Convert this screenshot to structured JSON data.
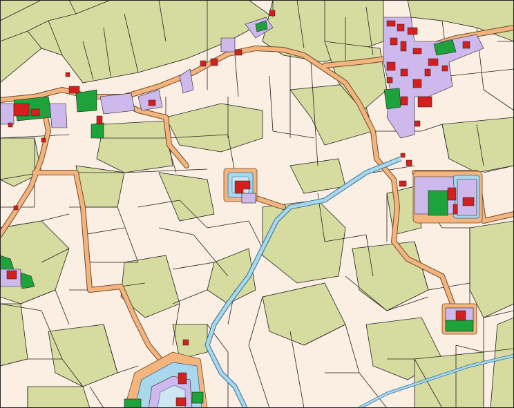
{
  "map": {
    "type": "cadastral land-use map",
    "labels": [],
    "legend": [],
    "colors": {
      "grassland": "#d6dca0",
      "arable": "#fbeee2",
      "road_fill": "#f3b47e",
      "road_edge": "#6d4a2a",
      "water_fill": "#a9d7ec",
      "water_edge": "#2f6e9a",
      "building": "#d41f1f",
      "yard": "#cdb9ec",
      "garden": "#1ea23b",
      "parcel_line": "#1f1f1f",
      "moat_inner": "#cfe6f0",
      "frame": "#222222"
    },
    "features": {
      "roads": [
        "northern-road",
        "east-village-loop",
        "southwest-road",
        "west-road",
        "inner-road"
      ],
      "waterways": [
        "central-canal",
        "southeast-stream",
        "moat-west",
        "moat-center",
        "moat-east"
      ],
      "settlements": [
        "north-village",
        "central-moated-farm",
        "east-farmstead",
        "southeast-farm",
        "southwest-moated-farm",
        "west-farm"
      ]
    }
  }
}
